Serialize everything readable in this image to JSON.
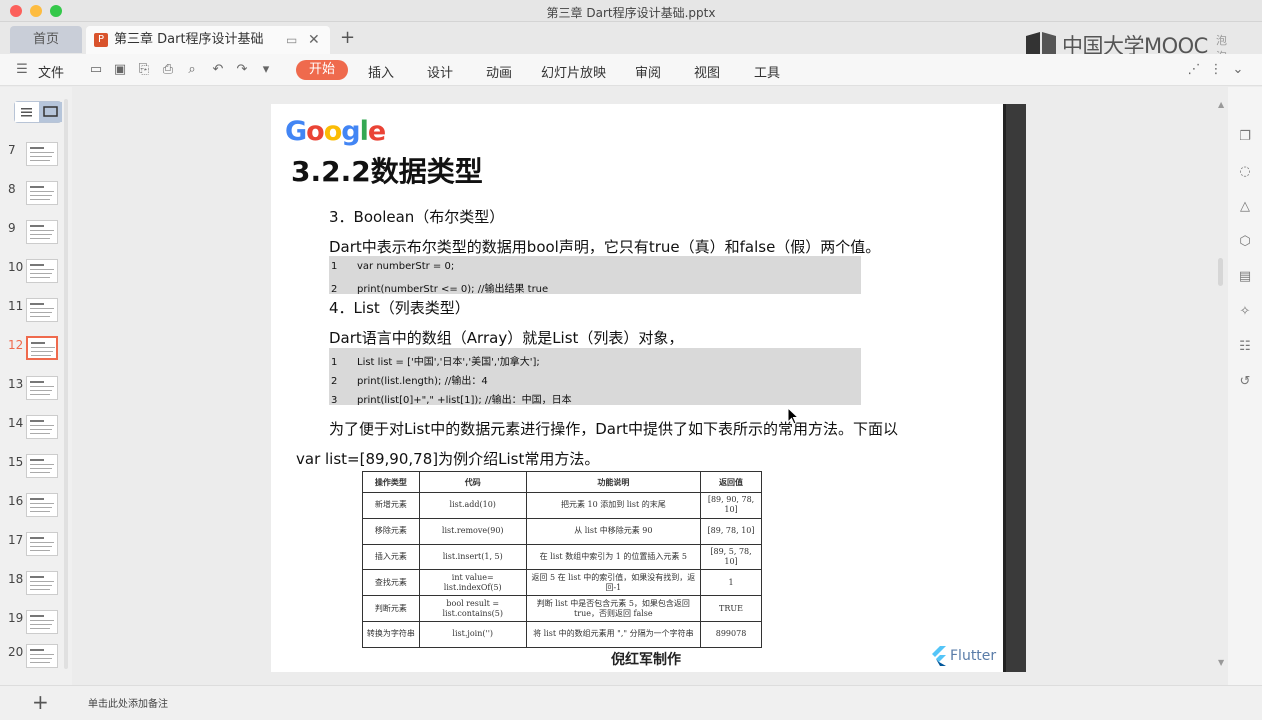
{
  "window": {
    "title": "第三章 Dart程序设计基础.pptx"
  },
  "tabs": {
    "home": "首页",
    "doc": "第三章 Dart程序设计基础",
    "add": "+"
  },
  "brand": {
    "logo_text": "中国大学MOOC",
    "user": "泡泡"
  },
  "toolbar": {
    "file": "文件",
    "items": [
      "开始",
      "插入",
      "设计",
      "动画",
      "幻灯片放映",
      "审阅",
      "视图",
      "工具"
    ],
    "active": "开始"
  },
  "thumbnails": {
    "numbers": [
      "7",
      "8",
      "9",
      "10",
      "11",
      "12",
      "13",
      "14",
      "15",
      "16",
      "17",
      "18",
      "19",
      "20"
    ],
    "active": "12"
  },
  "slide": {
    "logo": [
      "G",
      "o",
      "o",
      "g",
      "l",
      "e"
    ],
    "logo_colors": [
      "#4285F4",
      "#EA4335",
      "#FBBC05",
      "#4285F4",
      "#34A853",
      "#EA4335"
    ],
    "title": "3.2.2数据类型",
    "section3": "3．Boolean（布尔类型）",
    "para1": "Dart中表示布尔类型的数据用bool声明，它只有true（真）和false（假）两个值。",
    "code1": [
      {
        "n": "1",
        "t": "var numberStr = 0;"
      },
      {
        "n": "2",
        "t": "print(numberStr <= 0);    //输出结果 true"
      }
    ],
    "section4": "4．List（列表类型）",
    "para2": "Dart语言中的数组（Array）就是List（列表）对象，",
    "code2": [
      {
        "n": "1",
        "t": "List list = ['中国','日本','美国','加拿大'];"
      },
      {
        "n": "2",
        "t": "print(list.length);             //输出：4"
      },
      {
        "n": "3",
        "t": "print(list[0]+\",\" +list[1]); //输出：中国，日本"
      }
    ],
    "para3": "为了便于对List中的数据元素进行操作，Dart中提供了如下表所示的常用方法。下面以",
    "para4": "var list=[89,90,78]为例介绍List常用方法。",
    "table": {
      "headers": [
        "操作类型",
        "代码",
        "功能说明",
        "返回值"
      ],
      "rows": [
        [
          "新增元素",
          "list.add(10)",
          "把元素 10 添加到 list 的末尾",
          "[89, 90, 78, 10]"
        ],
        [
          "移除元素",
          "list.remove(90)",
          "从 list 中移除元素 90",
          "[89, 78, 10]"
        ],
        [
          "插入元素",
          "list.insert(1, 5)",
          "在 list 数组中索引为 1 的位置插入元素 5",
          "[89, 5, 78, 10]"
        ],
        [
          "查找元素",
          "int value= list.indexOf(5)",
          "返回 5 在 list 中的索引值，如果没有找到，返回-1",
          "1"
        ],
        [
          "判断元素",
          "bool result = list.contains(5)",
          "判断 list 中是否包含元素 5，如果包含返回 true，否则返回 false",
          "TRUE"
        ],
        [
          "转换为字符串",
          "list.join('')",
          "将 list 中的数组元素用 \",\" 分隔为一个字符串",
          "899078"
        ]
      ]
    },
    "author": "倪红军制作",
    "flutter": "Flutter"
  },
  "status": {
    "note": "单击此处添加备注"
  }
}
